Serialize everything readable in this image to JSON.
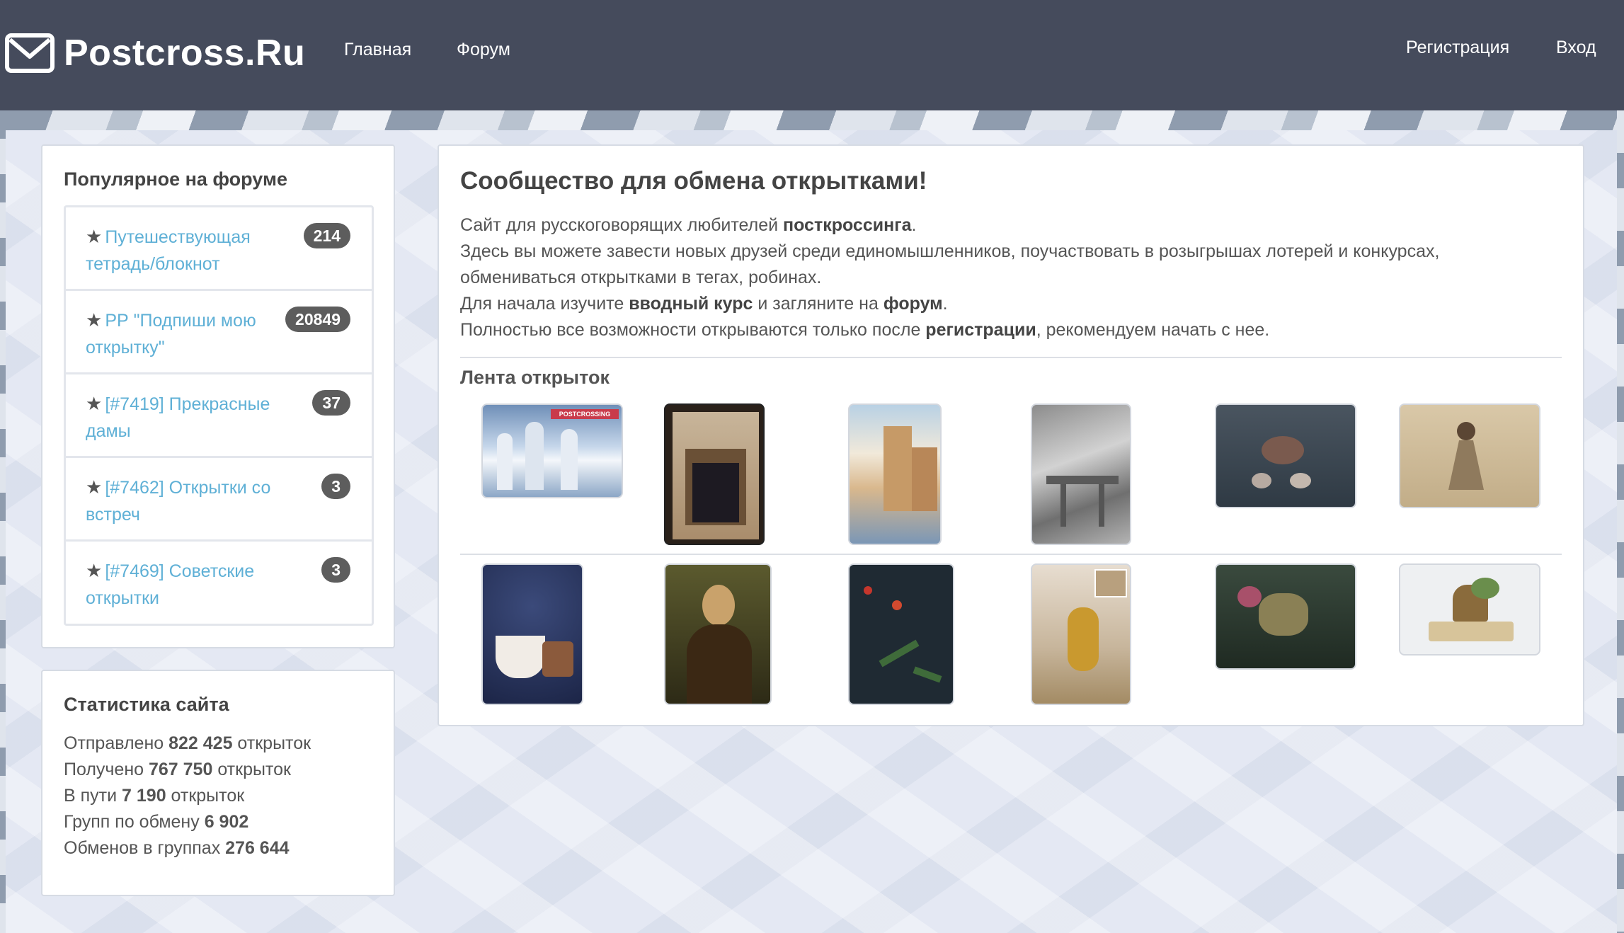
{
  "navbar": {
    "brand": "Postcross.Ru",
    "links": [
      "Главная",
      "Форум"
    ],
    "right_links": [
      "Регистрация",
      "Вход"
    ],
    "icons": {
      "brand": "envelope-icon"
    }
  },
  "forum": {
    "title": "Популярное на форуме",
    "items": [
      {
        "label": "Путешествующая тетрадь/блокнот",
        "count": "214"
      },
      {
        "label": "РР \"Подпиши мою открытку\"",
        "count": "20849"
      },
      {
        "label": "[#7419] Прекрасные дамы",
        "count": "37"
      },
      {
        "label": "[#7462] Открытки со встреч",
        "count": "3"
      },
      {
        "label": "[#7469] Советские открытки",
        "count": "3"
      }
    ],
    "icon": "star-icon"
  },
  "stats": {
    "title": "Статистика сайта",
    "rows": [
      {
        "prefix": "Отправлено ",
        "value": "822 425",
        "suffix": " открыток"
      },
      {
        "prefix": "Получено ",
        "value": "767 750",
        "suffix": " открыток"
      },
      {
        "prefix": "В пути ",
        "value": "7 190",
        "suffix": " открыток"
      },
      {
        "prefix": "Групп по обмену ",
        "value": "6 902",
        "suffix": ""
      },
      {
        "prefix": "Обменов в группах ",
        "value": "276 644",
        "suffix": ""
      }
    ]
  },
  "main": {
    "title": "Сообщество для обмена открытками!",
    "intro": {
      "line1_a": "Сайт для русскоговорящих любителей ",
      "line1_b": "посткроссинга",
      "line1_c": ".",
      "line2": "Здесь вы можете завести новых друзей среди единомышленников, поучаствовать в розыгрышах лотерей и конкурсах,",
      "line3": "обмениваться открытками в тегах, робинах.",
      "line4_a": "Для начала изучите ",
      "line4_b": "вводный курс",
      "line4_c": " и загляните на ",
      "line4_d": "форум",
      "line4_e": ".",
      "line5_a": "Полностью все возможности открываются только после ",
      "line5_b": "регистрации",
      "line5_c": ", рекомендуем начать с нее."
    },
    "feed_title": "Лента открыток",
    "thumb_text": "POSTCROSSING",
    "colors": {
      "accent": "#5fb0d6",
      "navbar": "#454b5c",
      "badge": "#5d5d5d"
    }
  }
}
